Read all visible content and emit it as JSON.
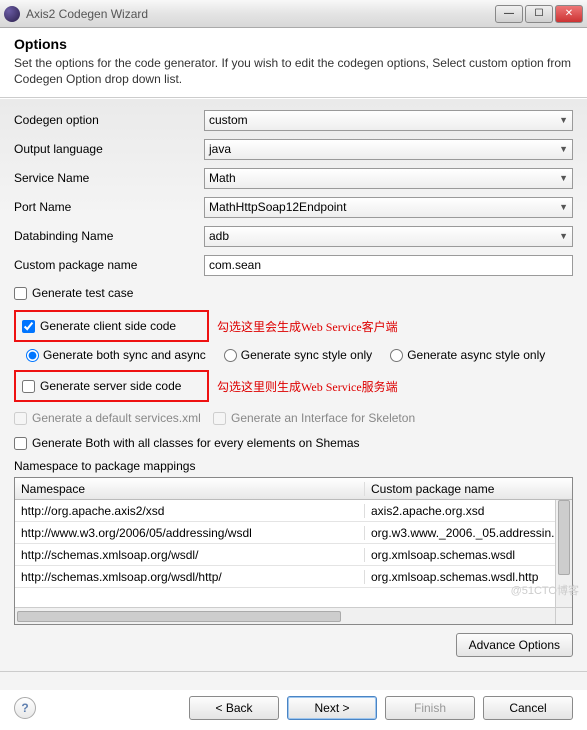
{
  "window": {
    "title": "Axis2 Codegen Wizard"
  },
  "header": {
    "title": "Options",
    "desc": "Set the options for the code generator. If you wish to edit the codegen options, Select custom option from Codegen Option drop down list."
  },
  "fields": {
    "codegen_option": {
      "label": "Codegen option",
      "value": "custom"
    },
    "output_language": {
      "label": "Output language",
      "value": "java"
    },
    "service_name": {
      "label": "Service Name",
      "value": "Math"
    },
    "port_name": {
      "label": "Port Name",
      "value": "MathHttpSoap12Endpoint"
    },
    "databinding_name": {
      "label": "Databinding Name",
      "value": "adb"
    },
    "custom_package": {
      "label": "Custom package name",
      "value": "com.sean"
    }
  },
  "checks": {
    "gen_test_case": "Generate test case",
    "gen_client": "Generate client side code",
    "gen_server": "Generate server side code",
    "gen_default_services": "Generate a default services.xml",
    "gen_interface_skeleton": "Generate an Interface for Skeleton",
    "gen_both_all": "Generate Both with all classes for every elements on Shemas"
  },
  "radios": {
    "both": "Generate both sync and async",
    "sync": "Generate sync style only",
    "async": "Generate async style only"
  },
  "annotations": {
    "client": "勾选这里会生成Web Service客户端",
    "server": "勾选这里则生成Web Service服务端"
  },
  "mappings": {
    "label": "Namespace to package mappings",
    "col_ns": "Namespace",
    "col_pkg": "Custom package name",
    "rows": [
      {
        "ns": "http://org.apache.axis2/xsd",
        "pkg": "axis2.apache.org.xsd"
      },
      {
        "ns": "http://www.w3.org/2006/05/addressing/wsdl",
        "pkg": "org.w3.www._2006._05.addressin."
      },
      {
        "ns": "http://schemas.xmlsoap.org/wsdl/",
        "pkg": "org.xmlsoap.schemas.wsdl"
      },
      {
        "ns": "http://schemas.xmlsoap.org/wsdl/http/",
        "pkg": "org.xmlsoap.schemas.wsdl.http"
      }
    ]
  },
  "buttons": {
    "advance": "Advance Options",
    "back": "< Back",
    "next": "Next >",
    "finish": "Finish",
    "cancel": "Cancel"
  },
  "watermark": "@51CTO博客"
}
